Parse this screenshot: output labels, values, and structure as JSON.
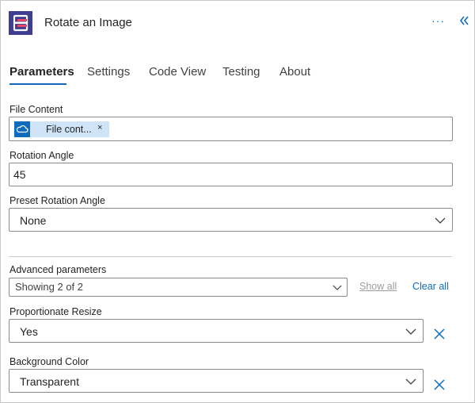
{
  "header": {
    "title": "Rotate an Image",
    "more_glyph": "···",
    "app_icon": "encodian-logo-icon",
    "collapse_icon": "double-chevron-left-icon"
  },
  "tabs": [
    {
      "label": "Parameters",
      "active": true
    },
    {
      "label": "Settings",
      "active": false
    },
    {
      "label": "Code View",
      "active": false
    },
    {
      "label": "Testing",
      "active": false
    },
    {
      "label": "About",
      "active": false
    }
  ],
  "fields": {
    "file_content": {
      "label": "File Content",
      "token_label": "File cont...",
      "token_close": "×",
      "token_icon": "onedrive-cloud-icon"
    },
    "rotation_angle": {
      "label": "Rotation Angle",
      "value": "45"
    },
    "preset_rotation_angle": {
      "label": "Preset Rotation Angle",
      "value": "None"
    }
  },
  "advanced": {
    "label": "Advanced parameters",
    "showing": "Showing 2 of 2",
    "show_all": "Show all",
    "clear_all": "Clear all"
  },
  "proportionate_resize": {
    "label": "Proportionate Resize",
    "value": "Yes"
  },
  "background_color": {
    "label": "Background Color",
    "value": "Transparent"
  },
  "colors": {
    "accent": "#0f6cbd",
    "token_bg": "#cfe4f6",
    "app_icon_bg": "#3f3d8f"
  }
}
